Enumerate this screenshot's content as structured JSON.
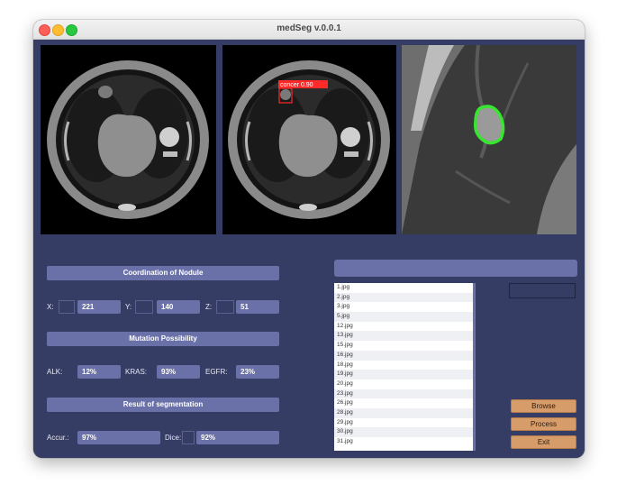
{
  "window": {
    "title": "medSeg v.0.0.1"
  },
  "images": [
    {
      "name": "ct-original"
    },
    {
      "name": "ct-detection",
      "detection_label": "concer 0.90",
      "box_color": "#ff2a2a"
    },
    {
      "name": "ct-segmentation-zoom",
      "contour_color": "#37e62e"
    }
  ],
  "coordination": {
    "header": "Coordination of Nodule",
    "x_label": "X:",
    "x": "221",
    "y_label": "Y:",
    "y": "140",
    "z_label": "Z:",
    "z": "51"
  },
  "mutation": {
    "header": "Mutation Possibility",
    "alk_label": "ALK:",
    "alk": "12%",
    "kras_label": "KRAS:",
    "kras": "93%",
    "egfr_label": "EGFR:",
    "egfr": "23%"
  },
  "segmentation": {
    "header": "Result of segmentation",
    "accur_label": "Accur.:",
    "accur": "97%",
    "dice_label": "Dice:",
    "dice": "92%"
  },
  "files": [
    "1.jpg",
    "2.jpg",
    "3.jpg",
    "5.jpg",
    "12.jpg",
    "13.jpg",
    "15.jpg",
    "16.jpg",
    "18.jpg",
    "19.jpg",
    "20.jpg",
    "23.jpg",
    "26.jpg",
    "28.jpg",
    "29.jpg",
    "30.jpg",
    "31.jpg"
  ],
  "buttons": {
    "browse": "Browse",
    "process": "Process",
    "exit": "Exit"
  },
  "colors": {
    "background": "#363d65",
    "accent": "#6a71a8",
    "button": "#d69c6a"
  }
}
